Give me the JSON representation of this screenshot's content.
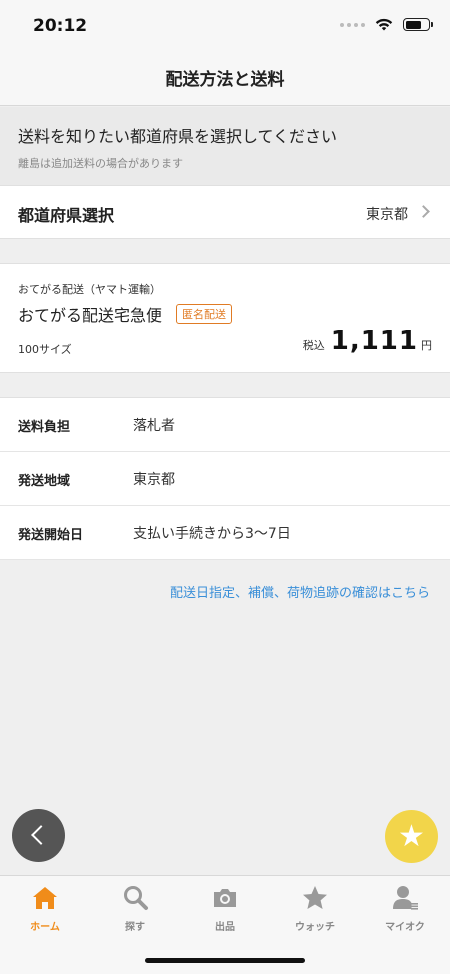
{
  "status": {
    "time": "20:12"
  },
  "nav": {
    "title": "配送方法と送料"
  },
  "notice": {
    "main": "送料を知りたい都道府県を選択してください",
    "sub": "離島は追加送料の場合があります"
  },
  "prefecture": {
    "label": "都道府県選択",
    "value": "東京都"
  },
  "shipping": {
    "provider": "おてがる配送（ヤマト運輸）",
    "name": "おてがる配送宅急便",
    "badge": "匿名配送",
    "size": "100サイズ",
    "price_prefix": "税込",
    "price": "1,111",
    "price_unit": "円"
  },
  "details": [
    {
      "label": "送料負担",
      "value": "落札者"
    },
    {
      "label": "発送地域",
      "value": "東京都"
    },
    {
      "label": "発送開始日",
      "value": "支払い手続きから3〜7日"
    }
  ],
  "info_link": "配送日指定、補償、荷物追跡の確認はこちら",
  "tabs": [
    {
      "label": "ホーム",
      "icon": "home-icon",
      "active": true
    },
    {
      "label": "探す",
      "icon": "search-icon",
      "active": false
    },
    {
      "label": "出品",
      "icon": "camera-icon",
      "active": false
    },
    {
      "label": "ウォッチ",
      "icon": "star-icon",
      "active": false
    },
    {
      "label": "マイオク",
      "icon": "user-icon",
      "active": false
    }
  ],
  "colors": {
    "accent": "#f08c1a",
    "badge": "#e07b24",
    "link": "#3a8fd8",
    "fab": "#f2d54a"
  }
}
